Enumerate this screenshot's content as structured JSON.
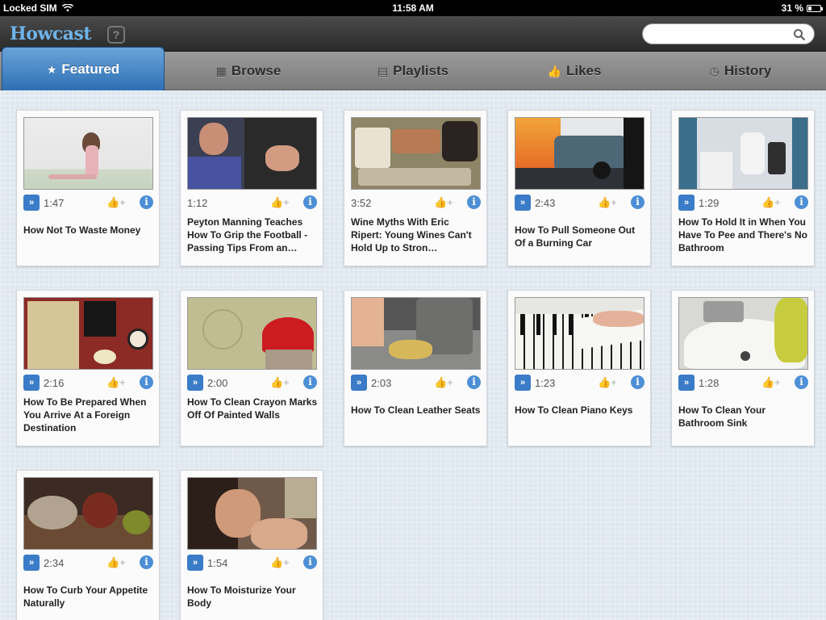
{
  "status": {
    "carrier": "Locked SIM",
    "time": "11:58 AM",
    "battery": "31 %"
  },
  "header": {
    "logo": "Howcast",
    "help_label": "?",
    "search_placeholder": ""
  },
  "tabs": [
    {
      "label": "Featured",
      "icon": "star-icon",
      "active": true
    },
    {
      "label": "Browse",
      "icon": "grid-icon",
      "active": false
    },
    {
      "label": "Playlists",
      "icon": "film-icon",
      "active": false
    },
    {
      "label": "Likes",
      "icon": "thumbs-up-icon",
      "active": false
    },
    {
      "label": "History",
      "icon": "clock-icon",
      "active": false
    }
  ],
  "card_ui": {
    "queue_glyph": "»",
    "like_glyph": "👍+",
    "info_glyph": "i"
  },
  "videos": [
    {
      "title": "How Not To Waste Money",
      "duration": "1:47",
      "queue": true
    },
    {
      "title": "Peyton Manning Teaches How To Grip the Football - Passing Tips From an…",
      "duration": "1:12",
      "queue": false
    },
    {
      "title": "Wine Myths With Eric Ripert: Young Wines Can't Hold Up to Stron…",
      "duration": "3:52",
      "queue": false
    },
    {
      "title": "How To Pull Someone Out Of a Burning Car",
      "duration": "2:43",
      "queue": true
    },
    {
      "title": "How To Hold It in When You Have To Pee and There's No Bathroom",
      "duration": "1:29",
      "queue": true
    },
    {
      "title": "How To Be Prepared When You Arrive At a Foreign Destination",
      "duration": "2:16",
      "queue": true
    },
    {
      "title": "How To Clean Crayon Marks Off Of Painted Walls",
      "duration": "2:00",
      "queue": true
    },
    {
      "title": "How To Clean Leather Seats",
      "duration": "2:03",
      "queue": true
    },
    {
      "title": "How To Clean Piano Keys",
      "duration": "1:23",
      "queue": true
    },
    {
      "title": "How To Clean Your Bathroom Sink",
      "duration": "1:28",
      "queue": true
    },
    {
      "title": "How To Curb Your Appetite Naturally",
      "duration": "2:34",
      "queue": true
    },
    {
      "title": "How To Moisturize Your Body",
      "duration": "1:54",
      "queue": true
    }
  ]
}
